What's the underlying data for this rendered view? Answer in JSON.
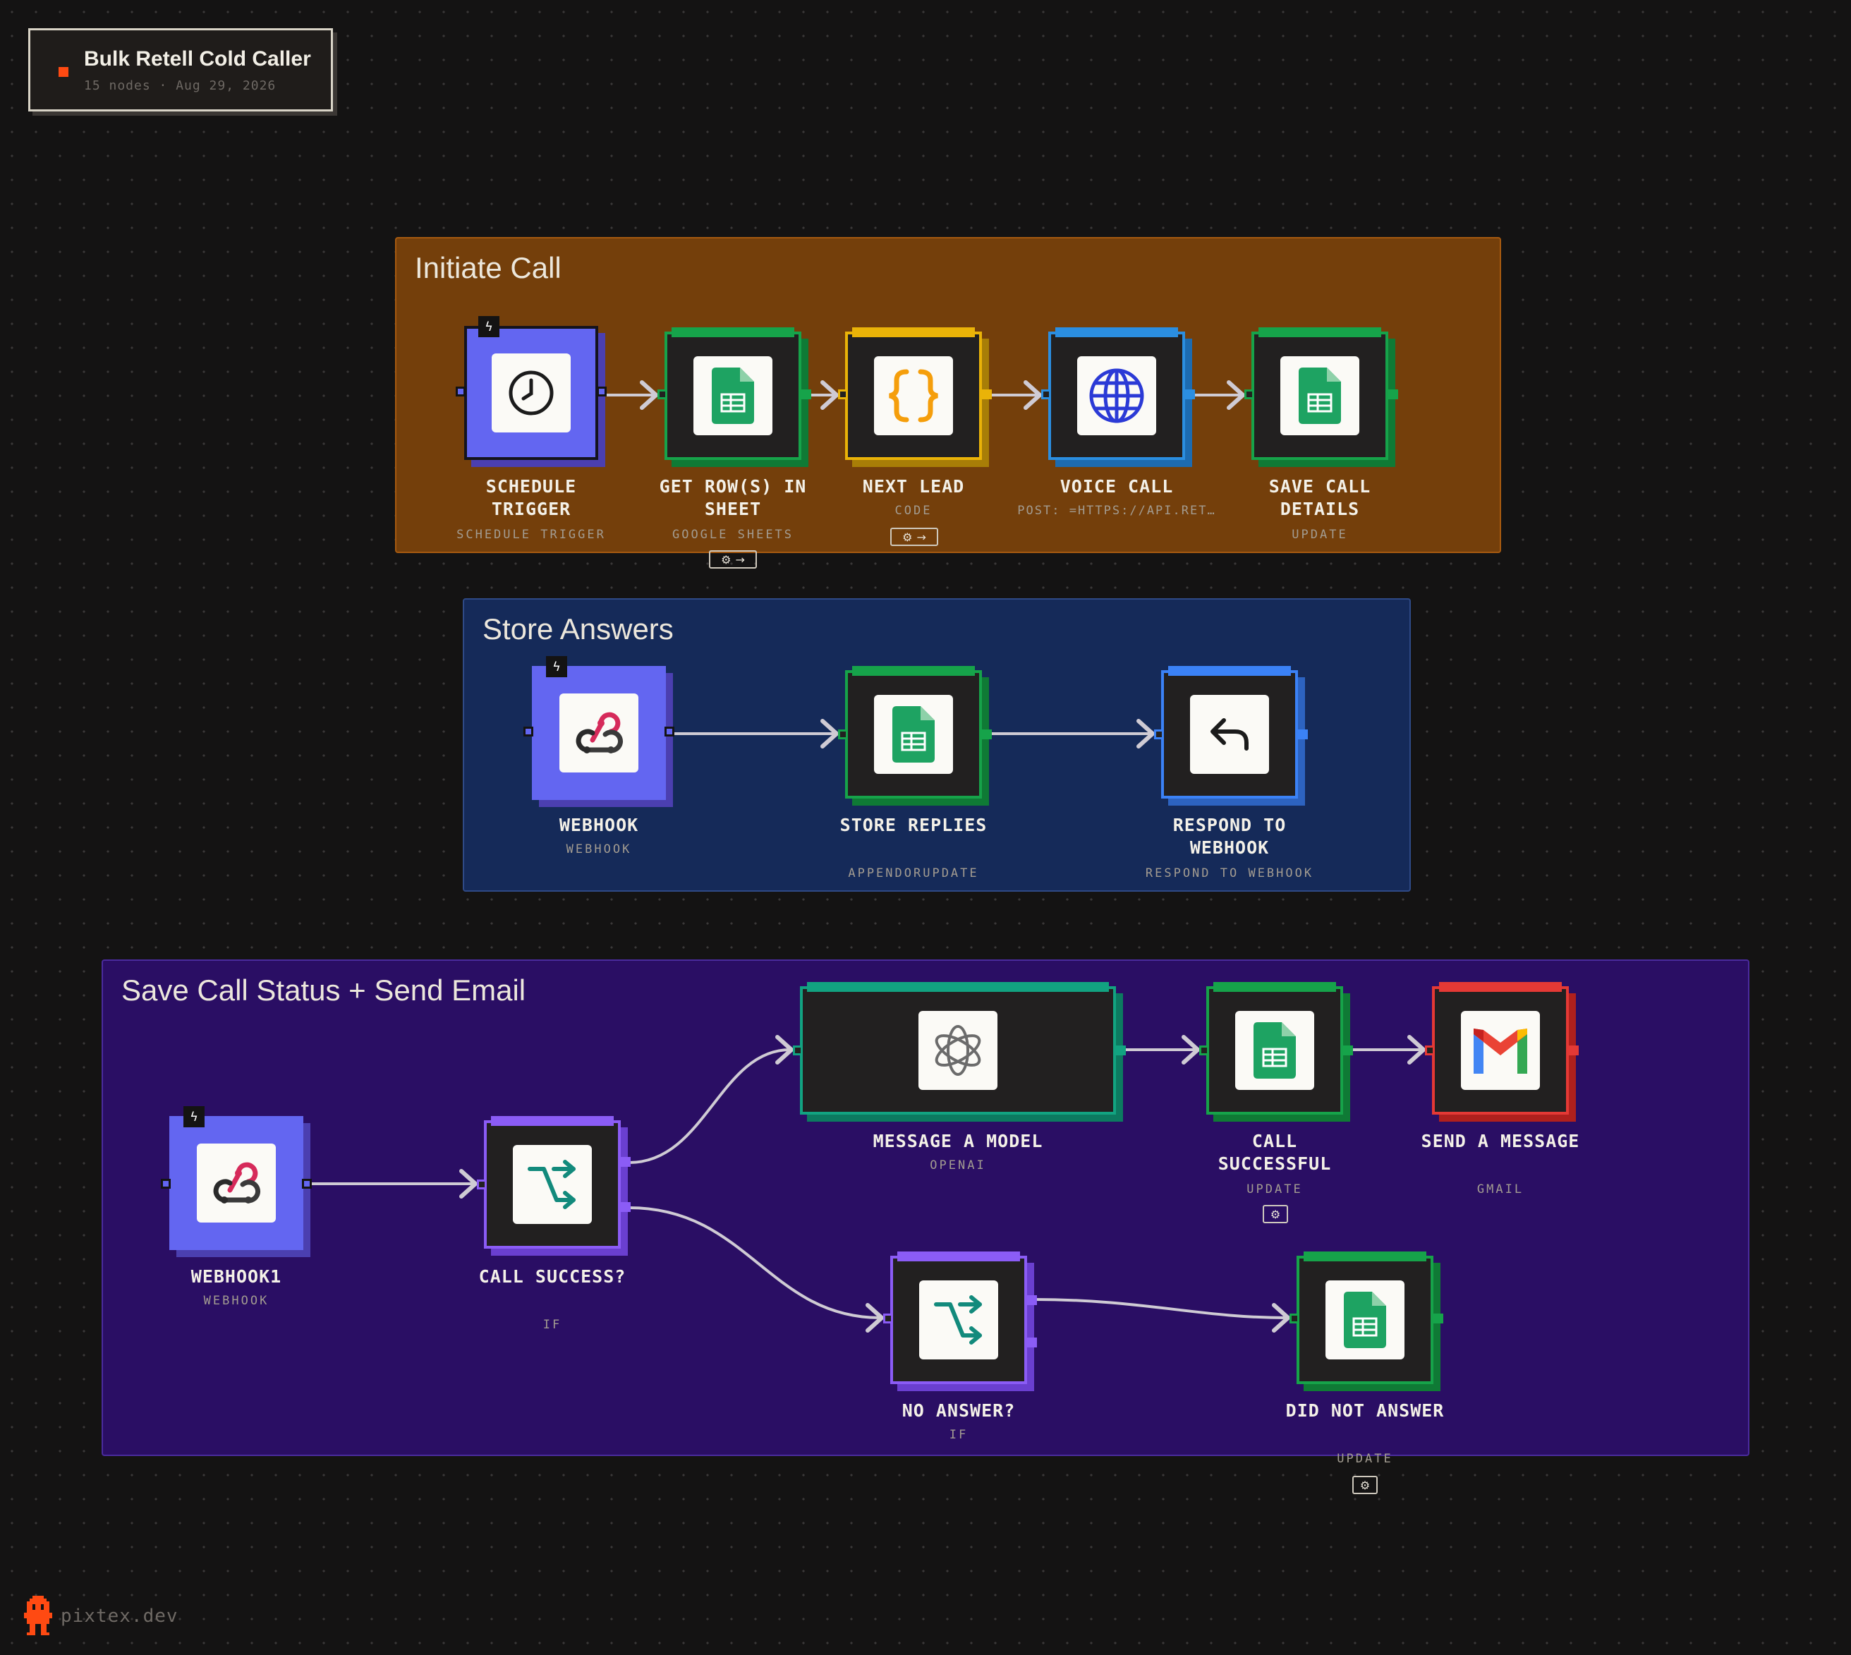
{
  "workflow": {
    "title": "Bulk Retell Cold Caller",
    "meta": "15 nodes · Aug 29, 2026"
  },
  "groups": {
    "initiate": {
      "label": "Initiate Call",
      "color": "#743f0b"
    },
    "store": {
      "label": "Store Answers",
      "color": "#152a59"
    },
    "status": {
      "label": "Save Call Status + Send Email",
      "color": "#2a0e64"
    }
  },
  "nodes": {
    "schedule_trigger": {
      "label": "SCHEDULE TRIGGER",
      "sub": "SCHEDULE TRIGGER",
      "icon": "clock-icon"
    },
    "get_rows": {
      "label": "GET ROW(S) IN SHEET",
      "sub": "GOOGLE SHEETS",
      "icon": "google-sheets-icon"
    },
    "next_lead": {
      "label": "NEXT LEAD",
      "sub": "CODE",
      "icon": "code-braces-icon"
    },
    "voice_call": {
      "label": "VOICE CALL",
      "sub": "POST: =HTTPS://API.RET…",
      "icon": "globe-icon"
    },
    "save_call_details": {
      "label": "SAVE CALL DETAILS",
      "sub": "UPDATE",
      "icon": "google-sheets-icon"
    },
    "webhook": {
      "label": "WEBHOOK",
      "sub": "WEBHOOK",
      "icon": "webhook-icon"
    },
    "store_replies": {
      "label": "STORE REPLIES",
      "sub": "APPENDORUPDATE",
      "icon": "google-sheets-icon"
    },
    "respond_webhook": {
      "label": "RESPOND TO WEBHOOK",
      "sub": "RESPOND TO WEBHOOK",
      "icon": "reply-arrow-icon"
    },
    "webhook1": {
      "label": "WEBHOOK1",
      "sub": "WEBHOOK",
      "icon": "webhook-icon"
    },
    "call_success": {
      "label": "CALL SUCCESS?",
      "sub": "IF",
      "icon": "branch-icon"
    },
    "message_model": {
      "label": "MESSAGE A MODEL",
      "sub": "OPENAI",
      "icon": "openai-icon"
    },
    "call_successful": {
      "label": "CALL SUCCESSFUL",
      "sub": "UPDATE",
      "icon": "google-sheets-icon"
    },
    "send_message": {
      "label": "SEND A MESSAGE",
      "sub": "GMAIL",
      "icon": "gmail-icon"
    },
    "no_answer": {
      "label": "NO ANSWER?",
      "sub": "IF",
      "icon": "branch-icon"
    },
    "did_not_answer": {
      "label": "DID NOT ANSWER",
      "sub": "UPDATE",
      "icon": "google-sheets-icon"
    }
  },
  "colors": {
    "trigger": "#6366f1",
    "sheets": "#16a34a",
    "code": "#eab308",
    "http": "#2b8ee0",
    "respond": "#3b82f6",
    "if": "#8b5cf6",
    "openai": "#12a381",
    "gmail": "#e53935"
  },
  "footer": {
    "brand": "pixtex.dev"
  }
}
